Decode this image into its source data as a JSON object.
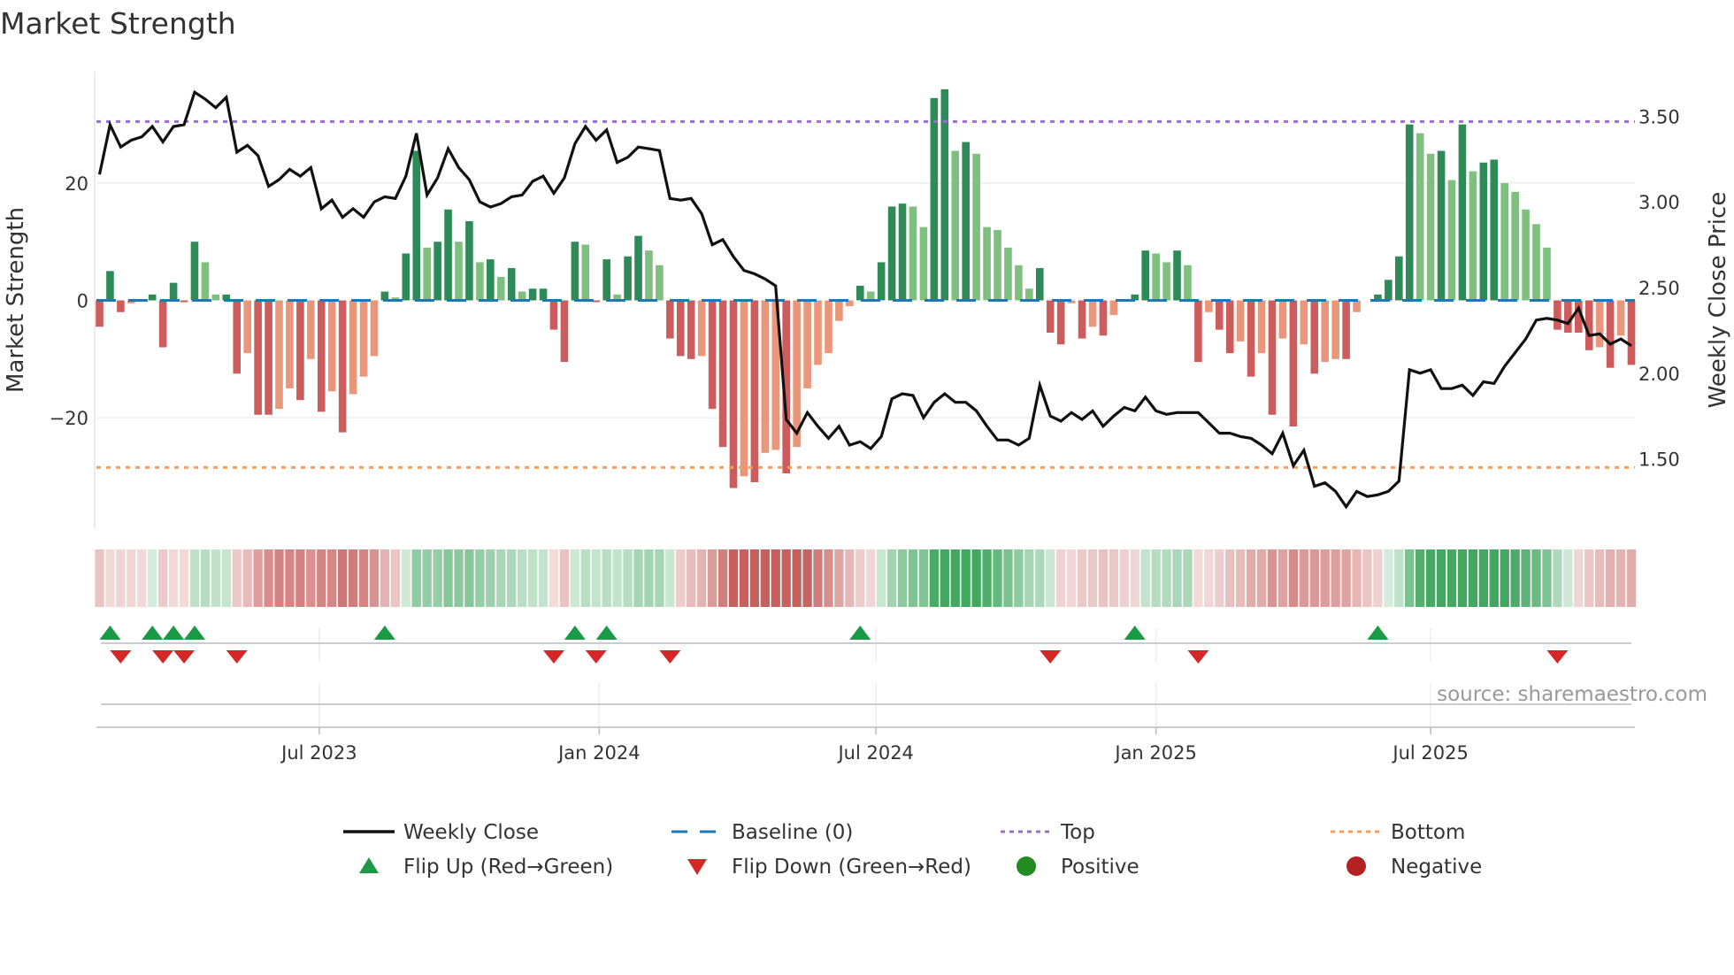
{
  "title": "Market Strength",
  "source": "source: sharemaestro.com",
  "colors": {
    "pos_strong": "#2e8b57",
    "pos_weak": "#7fbf7f",
    "neg_strong": "#cd5c5c",
    "neg_weak": "#e9967a",
    "baseline": "#1f77b4",
    "top": "#9b6bd6",
    "bottom": "#f0a060",
    "price": "#111111",
    "flip_up": "#1a9a45",
    "flip_down": "#d62728",
    "positive": "#228b22",
    "negative": "#b22222"
  },
  "legend": [
    {
      "key": "price",
      "label": "Weekly Close"
    },
    {
      "key": "baseline",
      "label": "Baseline (0)"
    },
    {
      "key": "top",
      "label": "Top"
    },
    {
      "key": "bottom",
      "label": "Bottom"
    },
    {
      "key": "flip_up",
      "label": "Flip Up (Red→Green)"
    },
    {
      "key": "flip_down",
      "label": "Flip Down (Green→Red)"
    },
    {
      "key": "positive",
      "label": "Positive"
    },
    {
      "key": "negative",
      "label": "Negative"
    }
  ],
  "chart_data": {
    "type": "bar",
    "title": "Market Strength",
    "ylabel": "Market Strength",
    "y2label": "Weekly Close Price",
    "ylim": [
      -39,
      39
    ],
    "y2lim": [
      1.09,
      3.76
    ],
    "yticks": [
      {
        "v": 20,
        "label": "20"
      },
      {
        "v": 0,
        "label": "0"
      },
      {
        "v": -20,
        "label": "−20"
      }
    ],
    "y2ticks": [
      {
        "v": 3.5,
        "label": "3.50"
      },
      {
        "v": 3.0,
        "label": "3.00"
      },
      {
        "v": 2.5,
        "label": "2.50"
      },
      {
        "v": 2.0,
        "label": "2.00"
      },
      {
        "v": 1.5,
        "label": "1.50"
      }
    ],
    "xticks": [
      {
        "week": 20.8,
        "label": "Jul 2023"
      },
      {
        "week": 47.3,
        "label": "Jan 2024"
      },
      {
        "week": 73.5,
        "label": "Jul 2024"
      },
      {
        "week": 100.0,
        "label": "Jan 2025"
      },
      {
        "week": 126.0,
        "label": "Jul 2025"
      }
    ],
    "top_level": 30.5,
    "bottom_level": -28.5,
    "strength": [
      -4.5,
      5,
      -2,
      -0.5,
      0,
      1,
      -8,
      3,
      -0.3,
      10,
      6.5,
      1,
      1,
      -12.5,
      -9,
      -19.5,
      -19.5,
      -18.5,
      -15,
      -17,
      -10,
      -19,
      -15.5,
      -22.5,
      -16,
      -13,
      -9.5,
      1.5,
      0.5,
      8,
      25.5,
      9,
      10,
      15.5,
      10,
      13.5,
      6.5,
      7,
      4,
      5.5,
      1.5,
      2,
      2,
      -5,
      -10.5,
      10,
      9.5,
      -0.3,
      7,
      1,
      7.5,
      11,
      8.5,
      6,
      -6.5,
      -9.5,
      -10,
      -9.5,
      -18.5,
      -25,
      -32,
      -30,
      -31,
      -26,
      -25.5,
      -29.5,
      -25,
      -15,
      -11,
      -9,
      -3.5,
      -1,
      2.5,
      1.5,
      6.5,
      16,
      16.5,
      16,
      12.5,
      34.5,
      36,
      25.5,
      27,
      25,
      12.5,
      12,
      9,
      6,
      2,
      5.5,
      -5.5,
      -7.5,
      -0.5,
      -6.5,
      -4.5,
      -6,
      -2.5,
      0,
      1,
      8.5,
      8,
      6.5,
      8.5,
      6,
      -10.5,
      -2,
      -5,
      -9,
      -7,
      -13,
      -9,
      -19.5,
      -6.5,
      -21.5,
      -7.5,
      -12.5,
      -10.5,
      -10,
      -10,
      -2,
      0,
      1,
      3.5,
      7.5,
      30,
      28.5,
      25,
      25.5,
      20.5,
      30,
      22,
      23.5,
      24,
      20,
      18.5,
      15.5,
      13,
      9,
      -5,
      -5.5,
      -5.5,
      -8.5,
      -8,
      -11.5,
      -6,
      -11
    ],
    "weekly_close": [
      3.16,
      3.45,
      3.32,
      3.36,
      3.38,
      3.44,
      3.35,
      3.44,
      3.45,
      3.64,
      3.6,
      3.55,
      3.61,
      3.29,
      3.33,
      3.27,
      3.09,
      3.13,
      3.19,
      3.15,
      3.2,
      2.96,
      3.01,
      2.91,
      2.96,
      2.91,
      3.0,
      3.03,
      3.02,
      3.15,
      3.4,
      3.04,
      3.14,
      3.31,
      3.2,
      3.13,
      3.0,
      2.97,
      2.99,
      3.03,
      3.04,
      3.12,
      3.15,
      3.05,
      3.14,
      3.34,
      3.44,
      3.36,
      3.42,
      3.23,
      3.26,
      3.32,
      3.31,
      3.3,
      3.02,
      3.01,
      3.02,
      2.93,
      2.75,
      2.78,
      2.68,
      2.6,
      2.58,
      2.55,
      2.51,
      1.73,
      1.65,
      1.77,
      1.69,
      1.62,
      1.69,
      1.58,
      1.6,
      1.56,
      1.63,
      1.85,
      1.88,
      1.87,
      1.74,
      1.83,
      1.88,
      1.83,
      1.83,
      1.78,
      1.69,
      1.61,
      1.61,
      1.58,
      1.62,
      1.93,
      1.75,
      1.72,
      1.77,
      1.73,
      1.78,
      1.69,
      1.75,
      1.8,
      1.78,
      1.86,
      1.78,
      1.76,
      1.77,
      1.77,
      1.77,
      1.71,
      1.65,
      1.65,
      1.63,
      1.62,
      1.58,
      1.53,
      1.65,
      1.46,
      1.55,
      1.34,
      1.36,
      1.31,
      1.22,
      1.31,
      1.28,
      1.29,
      1.31,
      1.37,
      2.02,
      2.0,
      2.02,
      1.91,
      1.91,
      1.93,
      1.87,
      1.95,
      1.94,
      2.04,
      2.12,
      2.2,
      2.31,
      2.32,
      2.31,
      2.29,
      2.38,
      2.22,
      2.23,
      2.17,
      2.2,
      2.16
    ]
  }
}
